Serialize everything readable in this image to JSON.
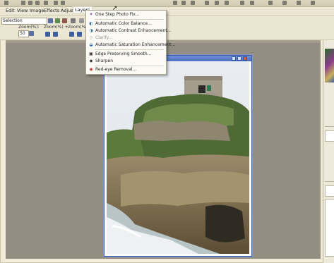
{
  "menubar": {
    "items": [
      {
        "label": "Edit"
      },
      {
        "label": "View"
      },
      {
        "label": "Image"
      },
      {
        "label": "Effects"
      },
      {
        "label": "Adjust"
      },
      {
        "label": "Layers"
      }
    ]
  },
  "toolbar": {
    "tool_combo": "Selection",
    "zoom_label": "Zoom(%):",
    "zoom_value": "50",
    "zoom_in_label": "Zoom(%) +",
    "zoom_out_label": "Zoom(%) -"
  },
  "adjust_menu": {
    "items": [
      {
        "label": "One Step Photo Fix...",
        "icon": "one-step-fix-icon",
        "enabled": true
      },
      {
        "label": "Automatic Color Balance...",
        "icon": "color-balance-icon",
        "enabled": true
      },
      {
        "label": "Automatic Contrast Enhancement...",
        "icon": "contrast-icon",
        "enabled": true
      },
      {
        "label": "Clarify...",
        "icon": "clarify-icon",
        "enabled": false
      },
      {
        "label": "Automatic Saturation Enhancement...",
        "icon": "saturation-icon",
        "enabled": true
      },
      {
        "label": "Edge Preserving Smooth...",
        "icon": "smooth-icon",
        "enabled": true
      },
      {
        "label": "Sharpen",
        "icon": "sharpen-icon",
        "enabled": true
      },
      {
        "label": "Red-eye Removal...",
        "icon": "red-eye-icon",
        "enabled": true
      }
    ]
  },
  "colors": {
    "workspace": "#938e81",
    "window_title": "#4e6fbf",
    "panel": "#eeeadb"
  }
}
